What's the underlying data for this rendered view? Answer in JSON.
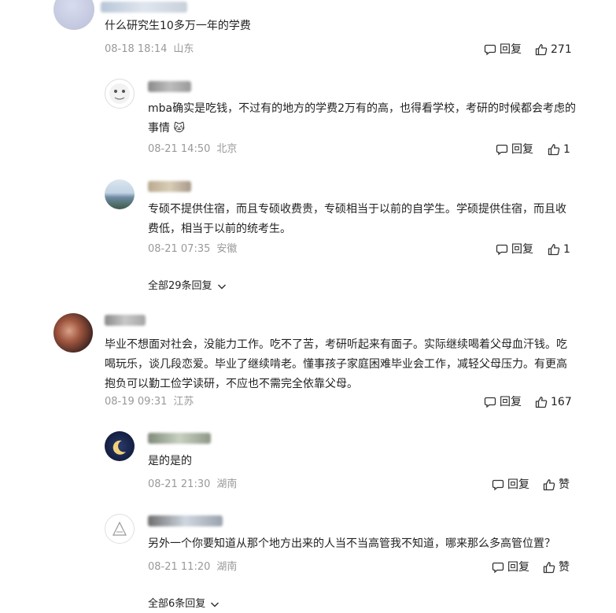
{
  "comments": [
    {
      "text": "什么研究生10多万一年的学费",
      "date": "08-18 18:14",
      "location": "山东",
      "reply_label": "回复",
      "likes": "271",
      "replies": [
        {
          "text": "mba确实是吃钱，不过有的地方的学费2万有的高，也得看学校，考研的时候都会考虑的事情 🐱",
          "date": "08-21 14:50",
          "location": "北京",
          "reply_label": "回复",
          "likes": "1"
        },
        {
          "text": "专硕不提供住宿，而且专硕收费贵，专硕相当于以前的自学生。学硕提供住宿，而且收费低，相当于以前的统考生。",
          "date": "08-21 07:35",
          "location": "安徽",
          "reply_label": "回复",
          "likes": "1"
        }
      ],
      "more_replies": "全部29条回复"
    },
    {
      "text": "毕业不想面对社会，没能力工作。吃不了苦，考研听起来有面子。实际继续喝着父母血汗钱。吃喝玩乐，谈几段恋爱。毕业了继续啃老。懂事孩子家庭困难毕业会工作，减轻父母压力。有更高抱负可以勤工俭学读研，不应也不需完全依靠父母。",
      "date": "08-19 09:31",
      "location": "江苏",
      "reply_label": "回复",
      "likes": "167",
      "replies": [
        {
          "text": "是的是的",
          "date": "08-21 21:30",
          "location": "湖南",
          "reply_label": "回复",
          "likes": "赞"
        },
        {
          "text": "另外一个你要知道从那个地方出来的人当不当高管我不知道，哪来那么多高管位置？",
          "date": "08-21 11:20",
          "location": "湖南",
          "reply_label": "回复",
          "likes": "赞"
        }
      ],
      "more_replies": "全部6条回复"
    }
  ],
  "colors": {
    "text": "#222222",
    "meta": "#999999",
    "background": "#ffffff"
  }
}
